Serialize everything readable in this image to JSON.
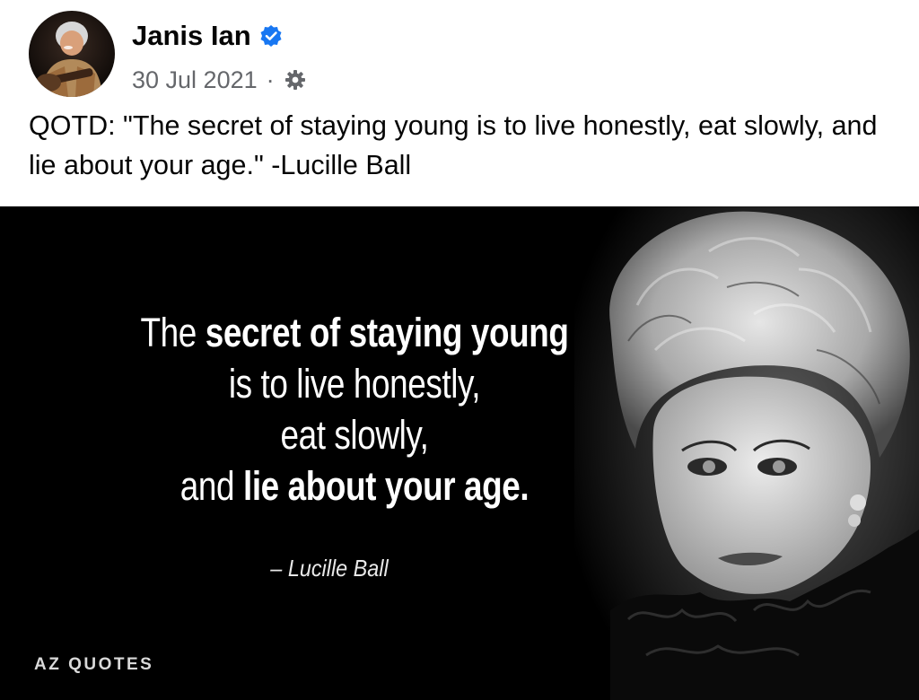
{
  "post": {
    "author": {
      "name": "Janis Ian",
      "verified": true,
      "avatar_icon": "profile-photo"
    },
    "meta": {
      "date": "30 Jul 2021",
      "separator": "·",
      "audience_icon": "gear-icon"
    },
    "text": "QOTD: \"The secret of staying young is to live honestly, eat slowly, and lie about your age.\" -Lucille Ball",
    "image": {
      "quote_lines": [
        {
          "a": "The ",
          "b": "secret of staying young",
          "c": ""
        },
        {
          "a": "is to live honestly,",
          "b": "",
          "c": ""
        },
        {
          "a": "eat slowly,",
          "b": "",
          "c": ""
        },
        {
          "a": "and ",
          "b": "lie about your age.",
          "c": ""
        }
      ],
      "attribution": "– Lucille Ball",
      "watermark": "AZ QUOTES"
    }
  },
  "colors": {
    "verified_blue": "#1877f2",
    "meta_gray": "#65676b",
    "image_bg": "#000000"
  }
}
